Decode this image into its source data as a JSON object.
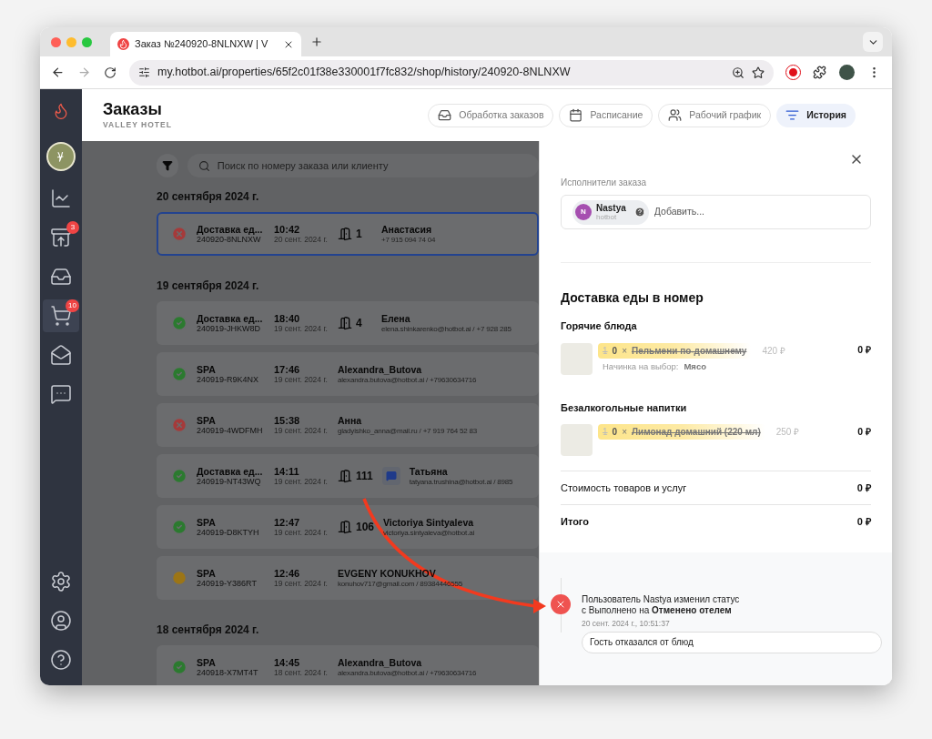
{
  "browser": {
    "tab_title": "Заказ №240920-8NLNXW | V",
    "url": "my.hotbot.ai/properties/65f2c01f38e330001f7fc832/shop/history/240920-8NLNXW"
  },
  "sidebar": {
    "top": [
      {
        "kind": "chart",
        "selected": false
      },
      {
        "kind": "download",
        "badge": "3",
        "selected": false
      },
      {
        "kind": "star",
        "selected": false
      },
      {
        "kind": "cart",
        "badge": "10",
        "selected": true
      },
      {
        "kind": "mail",
        "selected": false
      },
      {
        "kind": "chat",
        "selected": false
      }
    ],
    "bottom": [
      {
        "kind": "settings",
        "selected": false
      },
      {
        "kind": "user",
        "selected": false
      },
      {
        "kind": "help",
        "selected": false
      }
    ]
  },
  "header": {
    "title": "Заказы",
    "subtitle": "VALLEY HOTEL",
    "nav": [
      {
        "kind": "tray",
        "label": "Обработка заказов",
        "selected": false
      },
      {
        "kind": "calendar",
        "label": "Расписание",
        "selected": false
      },
      {
        "kind": "staff",
        "label": "Рабочий график",
        "selected": false
      },
      {
        "kind": "history",
        "label": "История",
        "selected": true
      }
    ]
  },
  "search": {
    "placeholder": "Поиск по номеру заказа или клиенту"
  },
  "groups": [
    {
      "date": "20 сентября 2024 г.",
      "orders": [
        {
          "kind": "canceled",
          "title": "Доставка ед...",
          "id": "240920-8NLNXW",
          "time": "10:42",
          "date": "20 сент. 2024 г.",
          "room": "1",
          "chat": false,
          "name": "Анастасия",
          "contact": "+7 915 094 74 04",
          "selected": true
        }
      ]
    },
    {
      "date": "19 сентября 2024 г.",
      "orders": [
        {
          "kind": "done",
          "title": "Доставка ед...",
          "id": "240919-JHKW8D",
          "time": "18:40",
          "date": "19 сент. 2024 г.",
          "room": "4",
          "chat": false,
          "name": "Елена",
          "contact": "elena.shinkarenko@hotbot.ai / +7 928 285",
          "selected": false
        },
        {
          "kind": "done",
          "title": "SPA",
          "id": "240919-R9K4NX",
          "time": "17:46",
          "date": "19 сент. 2024 г.",
          "chat": false,
          "name": "Alexandra_Butova",
          "contact": "alexandra.butova@hotbot.ai / +79630634716",
          "selected": false
        },
        {
          "kind": "canceled",
          "title": "SPA",
          "id": "240919-4WDFMH",
          "time": "15:38",
          "date": "19 сент. 2024 г.",
          "chat": false,
          "name": "Анна",
          "contact": "gladyishko_anna@mail.ru / +7 919 764 52 83",
          "selected": false
        },
        {
          "kind": "done",
          "title": "Доставка ед...",
          "id": "240919-NT43WQ",
          "time": "14:11",
          "date": "19 сент. 2024 г.",
          "room": "111",
          "chat": true,
          "name": "Татьяна",
          "contact": "tatyana.trushina@hotbot.ai / 8985",
          "selected": false
        },
        {
          "kind": "done",
          "title": "SPA",
          "id": "240919-D8KTYH",
          "time": "12:47",
          "date": "19 сент. 2024 г.",
          "room": "106",
          "chat": false,
          "name": "Victoriya Sintyaleva",
          "contact": "victoriya.sintyaleva@hotbot.ai",
          "selected": false
        },
        {
          "kind": "pending",
          "title": "SPA",
          "id": "240919-Y386RT",
          "time": "12:46",
          "date": "19 сент. 2024 г.",
          "chat": false,
          "name": "EVGENY KONUKHOV",
          "contact": "konuhov717@gmail.com / 89384446555",
          "selected": false
        }
      ]
    },
    {
      "date": "18 сентября 2024 г.",
      "orders": [
        {
          "kind": "done",
          "title": "SPA",
          "id": "240918-X7MT4T",
          "time": "14:45",
          "date": "18 сент. 2024 г.",
          "chat": false,
          "name": "Alexandra_Butova",
          "contact": "alexandra.butova@hotbot.ai / +79630634716",
          "selected": false
        }
      ]
    }
  ],
  "drawer": {
    "performers_label": "Исполнители заказа",
    "performer": {
      "initial": "N",
      "name": "Nastya",
      "org": "hotbot"
    },
    "add_placeholder": "Добавить...",
    "section_title": "Доставка еды в номер",
    "categories": [
      {
        "title": "Горячие блюда",
        "items": [
          {
            "old_qty": "1",
            "qty": "0",
            "times": "×",
            "name": "Пельмени по-домашнему",
            "price": "420 ₽",
            "total": "0 ₽",
            "struck": true,
            "option_label": "Начинка на выбор:",
            "option_value": "Мясо"
          }
        ]
      },
      {
        "title": "Безалкогольные напитки",
        "items": [
          {
            "old_qty": "1",
            "qty": "0",
            "times": "×",
            "name": "Лимонад домашний (220 мл)",
            "price": "250 ₽",
            "total": "0 ₽",
            "struck": true
          }
        ]
      }
    ],
    "summary": [
      {
        "label": "Стоимость товаров и услуг",
        "value": "0 ₽",
        "bold": false
      },
      {
        "label": "Итого",
        "value": "0 ₽",
        "bold": true
      }
    ],
    "history": {
      "kind": "canceled",
      "lines": [
        "Пользователь Nastya изменил статус",
        "с Выполнено на **Отменено отелем**"
      ],
      "timestamp": "20 сент. 2024 г., 10:51:37",
      "comment": "Гость отказался от блюд"
    }
  }
}
